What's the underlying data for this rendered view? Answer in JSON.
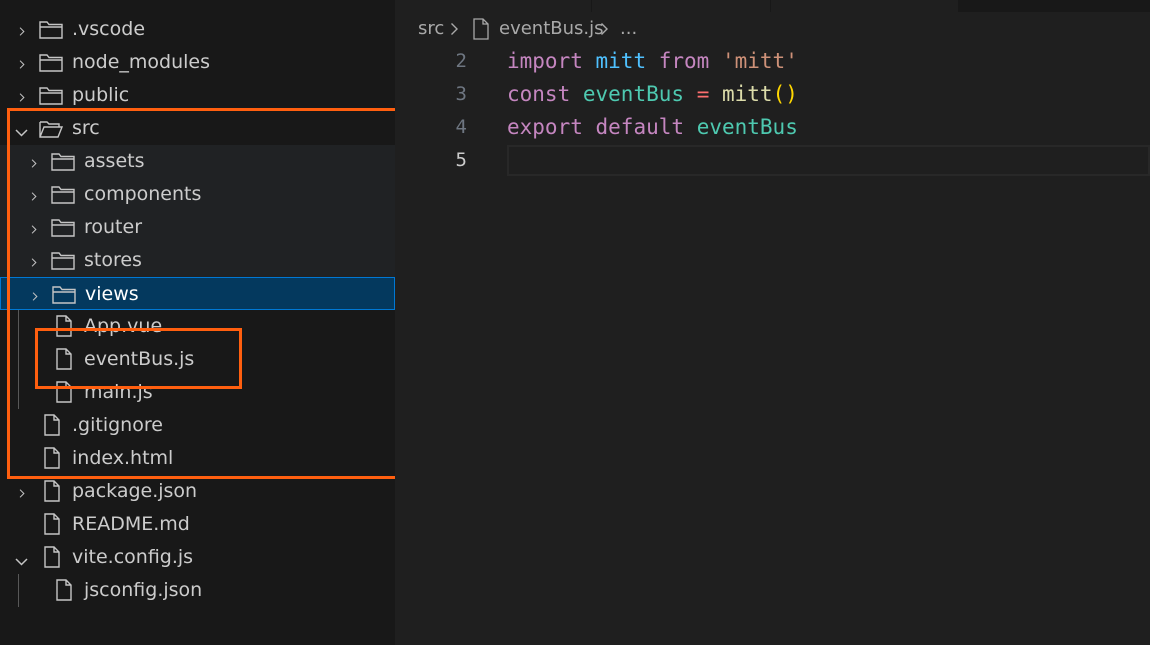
{
  "explorer": {
    "items": [
      {
        "name": ".vscode",
        "kind": "folder",
        "expanded": false
      },
      {
        "name": "node_modules",
        "kind": "folder",
        "expanded": false
      },
      {
        "name": "public",
        "kind": "folder",
        "expanded": false
      },
      {
        "name": "src",
        "kind": "folder",
        "expanded": true
      },
      {
        "name": "assets",
        "kind": "folder",
        "expanded": false
      },
      {
        "name": "components",
        "kind": "folder",
        "expanded": false
      },
      {
        "name": "router",
        "kind": "folder",
        "expanded": false
      },
      {
        "name": "stores",
        "kind": "folder",
        "expanded": false
      },
      {
        "name": "views",
        "kind": "folder",
        "expanded": false,
        "selected": true
      },
      {
        "name": "App.vue",
        "kind": "file"
      },
      {
        "name": "eventBus.js",
        "kind": "file"
      },
      {
        "name": "main.js",
        "kind": "file"
      },
      {
        "name": ".gitignore",
        "kind": "file"
      },
      {
        "name": "index.html",
        "kind": "file"
      },
      {
        "name": "package.json",
        "kind": "file",
        "has_chevron": true
      },
      {
        "name": "README.md",
        "kind": "file"
      },
      {
        "name": "vite.config.js",
        "kind": "file",
        "expanded": true
      },
      {
        "name": "jsconfig.json",
        "kind": "file"
      }
    ]
  },
  "breadcrumb": {
    "folder": "src",
    "file": "eventBus.js",
    "more": "..."
  },
  "editor": {
    "lines": [
      {
        "number": "2",
        "tokens": [
          {
            "text": "import",
            "color": "#c586c0"
          },
          {
            "text": " ",
            "color": "#d4d4d4"
          },
          {
            "text": "mitt",
            "color": "#4fc1ff"
          },
          {
            "text": " ",
            "color": "#d4d4d4"
          },
          {
            "text": "from",
            "color": "#c586c0"
          },
          {
            "text": " ",
            "color": "#d4d4d4"
          },
          {
            "text": "'mitt'",
            "color": "#ce9178"
          }
        ]
      },
      {
        "number": "3",
        "tokens": [
          {
            "text": "const",
            "color": "#c586c0"
          },
          {
            "text": " ",
            "color": "#d4d4d4"
          },
          {
            "text": "eventBus",
            "color": "#4ec9b0"
          },
          {
            "text": " ",
            "color": "#d4d4d4"
          },
          {
            "text": "=",
            "color": "#ff6f6f"
          },
          {
            "text": " ",
            "color": "#d4d4d4"
          },
          {
            "text": "mitt",
            "color": "#dcdcaa"
          },
          {
            "text": "()",
            "color": "#ffd700"
          }
        ]
      },
      {
        "number": "4",
        "tokens": [
          {
            "text": "export",
            "color": "#c586c0"
          },
          {
            "text": " ",
            "color": "#d4d4d4"
          },
          {
            "text": "default",
            "color": "#c586c0"
          },
          {
            "text": " ",
            "color": "#d4d4d4"
          },
          {
            "text": "eventBus",
            "color": "#4ec9b0"
          }
        ]
      },
      {
        "number": "5",
        "tokens": [],
        "current": true
      }
    ]
  },
  "colors": {
    "annotation": "#ff5f0f",
    "selection": "#04395e",
    "focus_border": "#0078d4"
  }
}
